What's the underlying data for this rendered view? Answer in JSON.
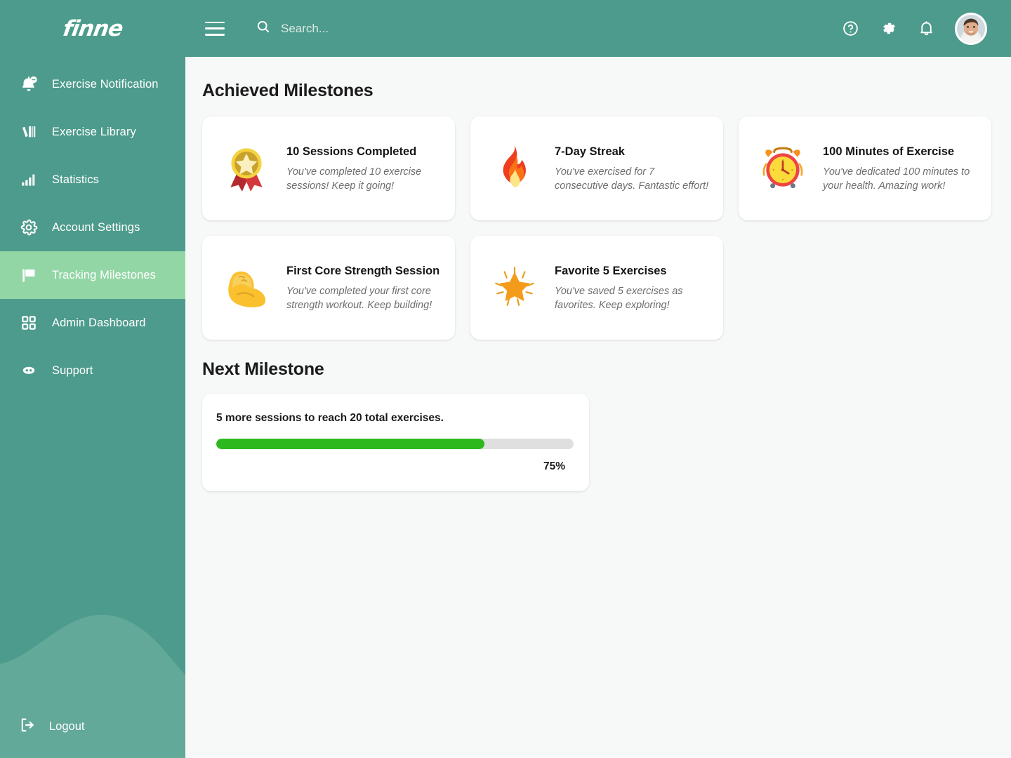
{
  "brand": {
    "logo_text": "finne"
  },
  "colors": {
    "sidebar": "#4d9b8c",
    "topbar": "#4d9b8c",
    "active_item": "#93d6a6",
    "progress_fill": "#2db91d",
    "progress_track": "#dfdfdf",
    "content_bg": "#f7f8f8"
  },
  "sidebar": {
    "items": [
      {
        "label": "Exercise Notification",
        "icon": "bell-notification-icon",
        "active": false
      },
      {
        "label": "Exercise Library",
        "icon": "books-icon",
        "active": false
      },
      {
        "label": "Statistics",
        "icon": "bar-chart-icon",
        "active": false
      },
      {
        "label": "Account Settings",
        "icon": "gear-icon",
        "active": false
      },
      {
        "label": "Tracking Milestones",
        "icon": "flag-icon",
        "active": true
      },
      {
        "label": "Admin Dashboard",
        "icon": "grid-icon",
        "active": false
      },
      {
        "label": "Support",
        "icon": "support-chat-icon",
        "active": false
      }
    ],
    "logout": {
      "label": "Logout",
      "icon": "logout-icon"
    }
  },
  "topbar": {
    "menu_icon": "hamburger-icon",
    "search": {
      "icon": "search-icon",
      "value": "",
      "placeholder": "Search..."
    },
    "actions": [
      {
        "icon": "help-circle-icon"
      },
      {
        "icon": "gear-icon"
      },
      {
        "icon": "bell-icon"
      }
    ],
    "avatar": {
      "icon": "avatar"
    }
  },
  "main": {
    "achieved_heading": "Achieved Milestones",
    "next_heading": "Next Milestone",
    "milestones": [
      {
        "emoji": "medal-icon",
        "title": "10 Sessions Completed",
        "description": "You've completed 10 exercise sessions! Keep it going!"
      },
      {
        "emoji": "fire-icon",
        "title": "7-Day Streak",
        "description": "You've exercised for 7 consecutive days. Fantastic effort!"
      },
      {
        "emoji": "alarm-clock-icon",
        "title": "100 Minutes of Exercise",
        "description": "You've dedicated 100 minutes to your health. Amazing work!"
      },
      {
        "emoji": "flexed-biceps-icon",
        "title": "First Core Strength Session",
        "description": "You've completed your first core strength workout. Keep building!"
      },
      {
        "emoji": "glowing-star-icon",
        "title": "Favorite 5 Exercises",
        "description": "You've saved 5 exercises as favorites. Keep exploring!"
      }
    ],
    "next_milestone": {
      "text": "5 more sessions to reach 20 total exercises.",
      "percent_label": "75%",
      "percent_value": 75
    }
  }
}
